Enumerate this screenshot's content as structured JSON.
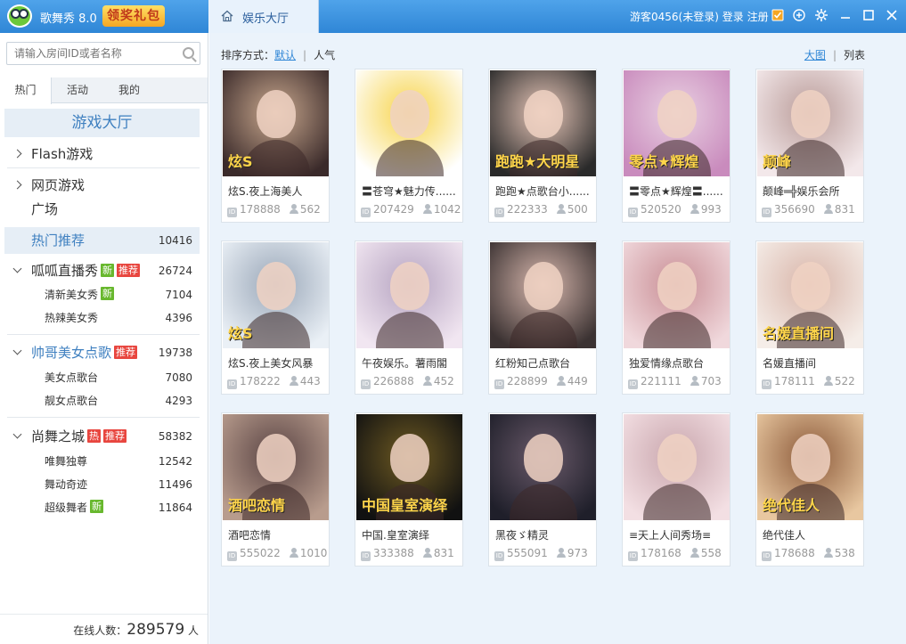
{
  "app": {
    "name": "歌舞秀 8.0",
    "promo": "领奖礼包"
  },
  "tab": {
    "label": "娱乐大厅"
  },
  "user": {
    "name": "游客0456(未登录)",
    "login": "登录",
    "register": "注册"
  },
  "search": {
    "placeholder": "请输入房间ID或者名称"
  },
  "sidebar_tabs": [
    "热门",
    "活动",
    "我的"
  ],
  "hall": "游戏大厅",
  "nav": {
    "flash": "Flash游戏",
    "web": "网页游戏",
    "plaza": "广场",
    "hot": {
      "label": "热门推荐",
      "count": "10416"
    },
    "guagua": {
      "label": "呱呱直播秀",
      "badges": [
        "新",
        "推荐"
      ],
      "count": "26724"
    },
    "guagua_sub": [
      {
        "label": "清新美女秀",
        "badge": "新",
        "count": "7104"
      },
      {
        "label": "热辣美女秀",
        "count": "4396"
      }
    ],
    "shuaige": {
      "label": "帅哥美女点歌",
      "badge": "推荐",
      "count": "19738"
    },
    "shuaige_sub": [
      {
        "label": "美女点歌台",
        "count": "7080"
      },
      {
        "label": "靓女点歌台",
        "count": "4293"
      }
    ],
    "shangwu": {
      "label": "尚舞之城",
      "badges": [
        "热",
        "推荐"
      ],
      "count": "58382"
    },
    "shangwu_sub": [
      {
        "label": "唯舞独尊",
        "count": "12542"
      },
      {
        "label": "舞动奇迹",
        "count": "11496"
      },
      {
        "label": "超级舞者",
        "badge": "新",
        "count": "11864"
      }
    ]
  },
  "online": {
    "label": "在线人数：",
    "count": "289579",
    "unit": "人"
  },
  "sort": {
    "label": "排序方式：",
    "default": "默认",
    "popularity": "人气"
  },
  "view": {
    "large": "大图",
    "list": "列表"
  },
  "rooms": [
    {
      "name": "炫S.夜上海美人",
      "id": "178888",
      "users": "562",
      "overlay": "炫S",
      "colors": [
        "#3a2a2a",
        "#c9a88e"
      ]
    },
    {
      "name": "〓苍穹★魅力传......",
      "id": "207429",
      "users": "1042",
      "overlay": "",
      "colors": [
        "#ffffff",
        "#f7d44a"
      ]
    },
    {
      "name": "跑跑★点歌台小......",
      "id": "222333",
      "users": "500",
      "overlay": "跑跑★大明星",
      "colors": [
        "#2a2a2a",
        "#e7c6b8"
      ]
    },
    {
      "name": "〓零点★辉煌〓......",
      "id": "520520",
      "users": "993",
      "overlay": "零点★辉煌",
      "colors": [
        "#c98bbd",
        "#e9d1e2"
      ]
    },
    {
      "name": "颠峰═╬娱乐会所",
      "id": "356690",
      "users": "831",
      "overlay": "颠峰",
      "colors": [
        "#f3e8ea",
        "#b99b98"
      ]
    },
    {
      "name": "炫S.夜上美女风暴",
      "id": "178222",
      "users": "443",
      "overlay": "炫S",
      "colors": [
        "#eaf0f6",
        "#9aa7b8"
      ]
    },
    {
      "name": "午夜娱乐。薯雨閣",
      "id": "226888",
      "users": "452",
      "overlay": "",
      "colors": [
        "#f1e6f1",
        "#b6a4c1"
      ]
    },
    {
      "name": "红粉知己点歌台",
      "id": "228899",
      "users": "449",
      "overlay": "",
      "colors": [
        "#3b3232",
        "#d7b7ad"
      ]
    },
    {
      "name": "独爱情缘点歌台",
      "id": "221111",
      "users": "703",
      "overlay": "",
      "colors": [
        "#f0d8dc",
        "#c98e95"
      ]
    },
    {
      "name": "名媛直播间",
      "id": "178111",
      "users": "522",
      "overlay": "名媛直播间",
      "colors": [
        "#f5ede8",
        "#d8b4a8"
      ]
    },
    {
      "name": "酒吧恋情",
      "id": "555022",
      "users": "1010",
      "overlay": "酒吧恋情",
      "colors": [
        "#b89c8d",
        "#5a4444"
      ]
    },
    {
      "name": "中国.皇室演绎",
      "id": "333388",
      "users": "831",
      "overlay": "中国皇室演绎",
      "colors": [
        "#111111",
        "#6e5a22"
      ]
    },
    {
      "name": "黑夜ゞ精灵",
      "id": "555091",
      "users": "973",
      "overlay": "",
      "colors": [
        "#1f1f2a",
        "#6a5a6a"
      ]
    },
    {
      "name": "≡天上人间秀场≡",
      "id": "178168",
      "users": "558",
      "overlay": "",
      "colors": [
        "#f3dfe3",
        "#c9a6ad"
      ]
    },
    {
      "name": "绝代佳人",
      "id": "178688",
      "users": "538",
      "overlay": "绝代佳人",
      "colors": [
        "#e8c7a0",
        "#8c5a3a"
      ]
    }
  ]
}
